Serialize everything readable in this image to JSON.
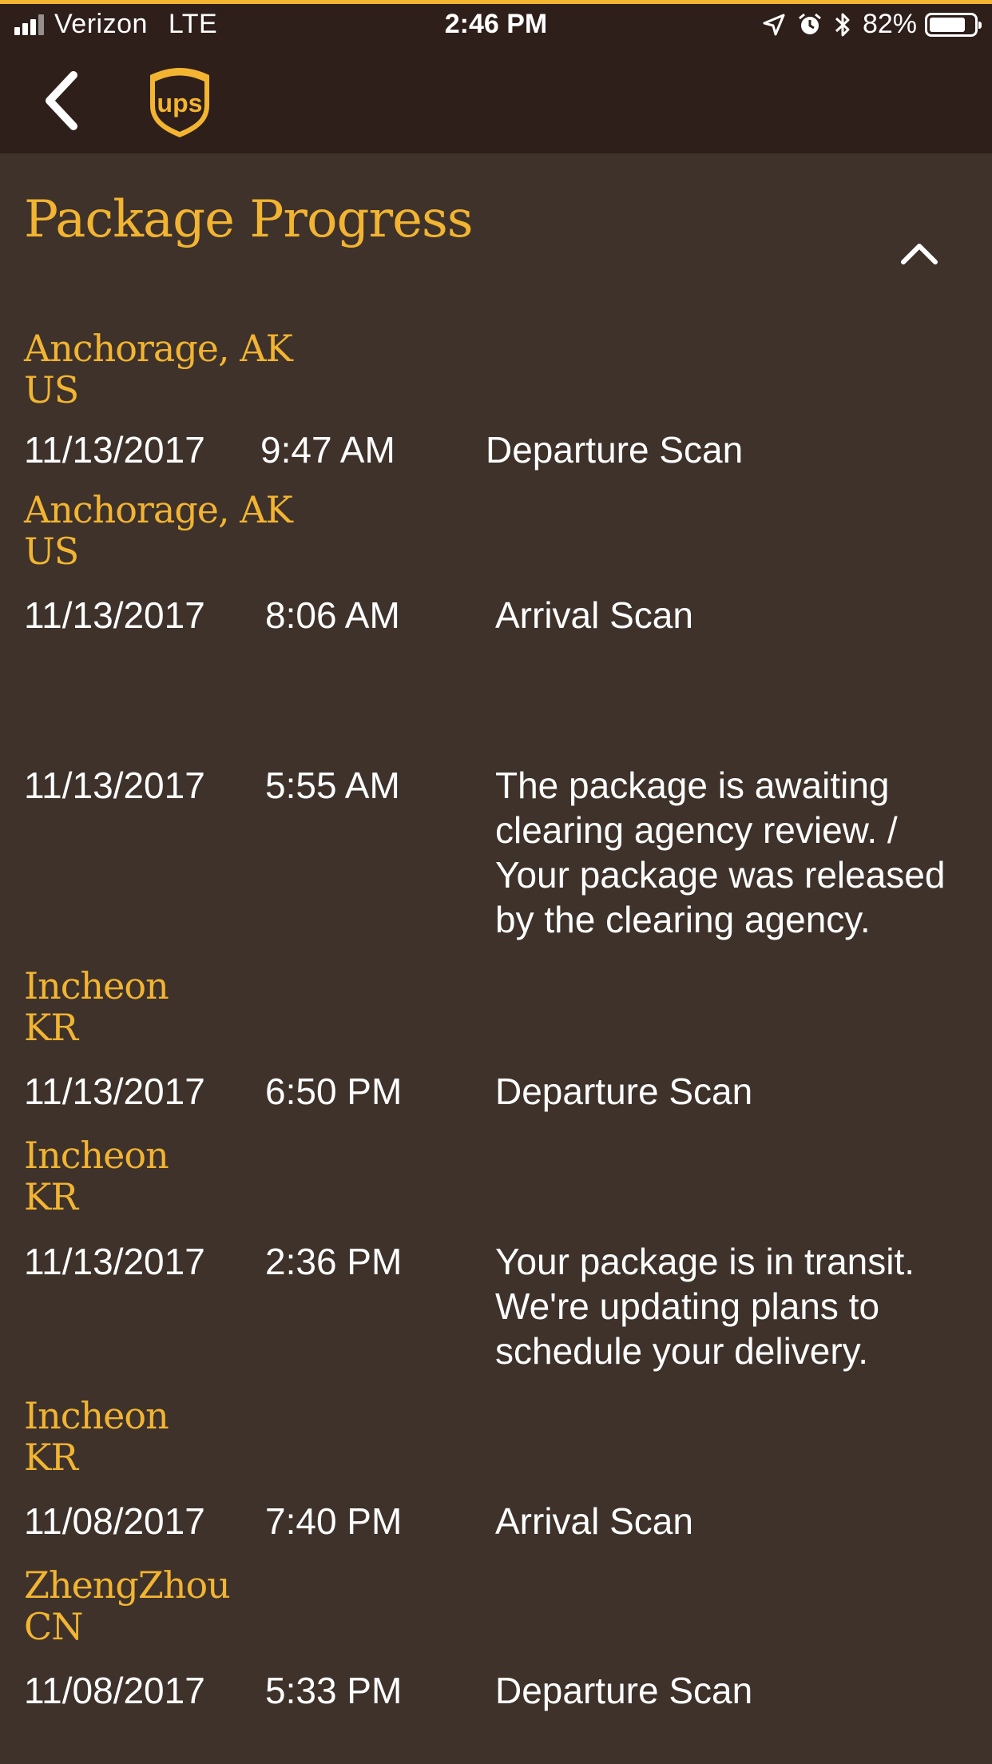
{
  "status_bar": {
    "carrier": "Verizon",
    "network": "LTE",
    "time": "2:46 PM",
    "battery": "82%",
    "battery_level": 0.82,
    "icons": [
      "signal-icon",
      "location-icon",
      "alarm-icon",
      "bluetooth-icon",
      "battery-icon"
    ]
  },
  "nav": {
    "back_icon": "chevron-left-icon",
    "logo_text": "ups",
    "colors": {
      "bar": "#2e1f1a",
      "accent": "#f2b431"
    }
  },
  "section": {
    "title": "Package Progress",
    "collapse_icon": "chevron-up-icon"
  },
  "events": [
    {
      "location_line1": "Anchorage, AK",
      "location_line2": "US",
      "date": "11/13/2017",
      "time": "9:47 AM",
      "desc": "Departure Scan"
    },
    {
      "location_line1": "Anchorage, AK",
      "location_line2": "US",
      "date": "11/13/2017",
      "time": "8:06 AM",
      "desc": "Arrival Scan"
    },
    {
      "location_line1": "",
      "location_line2": "",
      "date": "11/13/2017",
      "time": "5:55 AM",
      "desc": "The package is awaiting clearing agency review. / Your package was released by the clearing agency."
    },
    {
      "location_line1": "Incheon",
      "location_line2": "KR",
      "date": "11/13/2017",
      "time": "6:50 PM",
      "desc": "Departure Scan"
    },
    {
      "location_line1": "Incheon",
      "location_line2": "KR",
      "date": "11/13/2017",
      "time": "2:36 PM",
      "desc": "Your package is in transit. We're updating plans to schedule your delivery."
    },
    {
      "location_line1": "Incheon",
      "location_line2": "KR",
      "date": "11/08/2017",
      "time": "7:40 PM",
      "desc": "Arrival Scan"
    },
    {
      "location_line1": "ZhengZhou",
      "location_line2": "CN",
      "date": "11/08/2017",
      "time": "5:33 PM",
      "desc": "Departure Scan"
    }
  ]
}
